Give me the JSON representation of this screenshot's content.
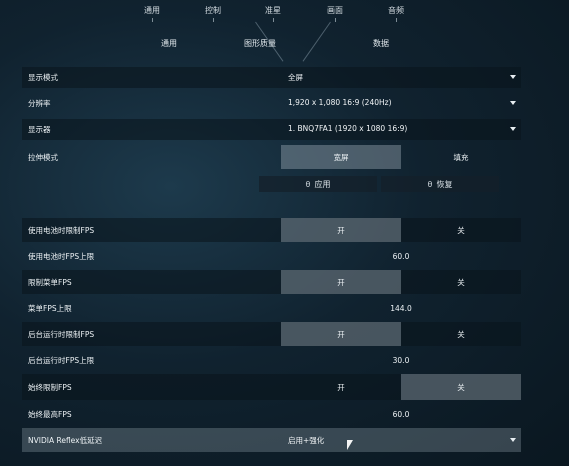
{
  "top_tabs": [
    {
      "label": "通用"
    },
    {
      "label": "控制"
    },
    {
      "label": "准星"
    },
    {
      "label": "画面"
    },
    {
      "label": "音频"
    }
  ],
  "sub_tabs": [
    {
      "label": "通用"
    },
    {
      "label": "图形质量"
    },
    {
      "label": "数据"
    }
  ],
  "settings": {
    "display_mode": {
      "label": "显示模式",
      "value": "全屏"
    },
    "resolution": {
      "label": "分辨率",
      "value": "1,920 x 1,080 16:9 (240Hz)"
    },
    "monitor": {
      "label": "显示器",
      "value": "1. BNQ7FA1 (1920 x 1080 16:9)"
    },
    "stretch": {
      "label": "拉伸模式",
      "opt_a": "宽屏",
      "opt_b": "填充",
      "selected": "opt_a"
    },
    "actions": {
      "apply": "应用",
      "restore": "恢复"
    },
    "battery_limit": {
      "label": "使用电池时限制FPS",
      "on": "开",
      "off": "关",
      "selected": "on"
    },
    "battery_cap": {
      "label": "使用电池时FPS上限",
      "value": "60.0"
    },
    "menu_limit": {
      "label": "限制菜单FPS",
      "on": "开",
      "off": "关",
      "selected": "on"
    },
    "menu_cap": {
      "label": "菜单FPS上限",
      "value": "144.0"
    },
    "bg_limit": {
      "label": "后台运行时限制FPS",
      "on": "开",
      "off": "关",
      "selected": "on"
    },
    "bg_cap": {
      "label": "后台运行时FPS上限",
      "value": "30.0"
    },
    "always_limit": {
      "label": "始终限制FPS",
      "on": "开",
      "off": "关",
      "selected": "off"
    },
    "always_cap": {
      "label": "始终最高FPS",
      "value": "60.0"
    },
    "reflex": {
      "label": "NVIDIA Reflex低延迟",
      "value": "启用+强化"
    }
  }
}
